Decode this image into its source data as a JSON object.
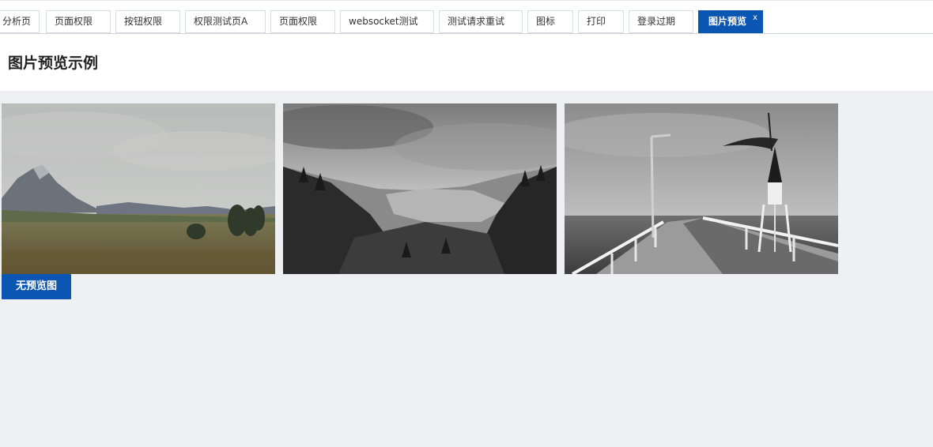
{
  "tabs": [
    {
      "label": "分析页"
    },
    {
      "label": "页面权限"
    },
    {
      "label": "按钮权限"
    },
    {
      "label": "权限测试页A"
    },
    {
      "label": "页面权限"
    },
    {
      "label": "websocket测试"
    },
    {
      "label": "测试请求重试"
    },
    {
      "label": "图标"
    },
    {
      "label": "打印"
    },
    {
      "label": "登录过期"
    },
    {
      "label": "图片预览",
      "close": "x"
    }
  ],
  "page": {
    "title": "图片预览示例",
    "no_preview_button": "无预览图"
  },
  "images": [
    {
      "name": "mountain-meadow-image"
    },
    {
      "name": "forest-valley-image"
    },
    {
      "name": "pier-lighthouse-image"
    }
  ],
  "colors": {
    "accent": "#0b56b3",
    "background": "#eff0f3"
  }
}
